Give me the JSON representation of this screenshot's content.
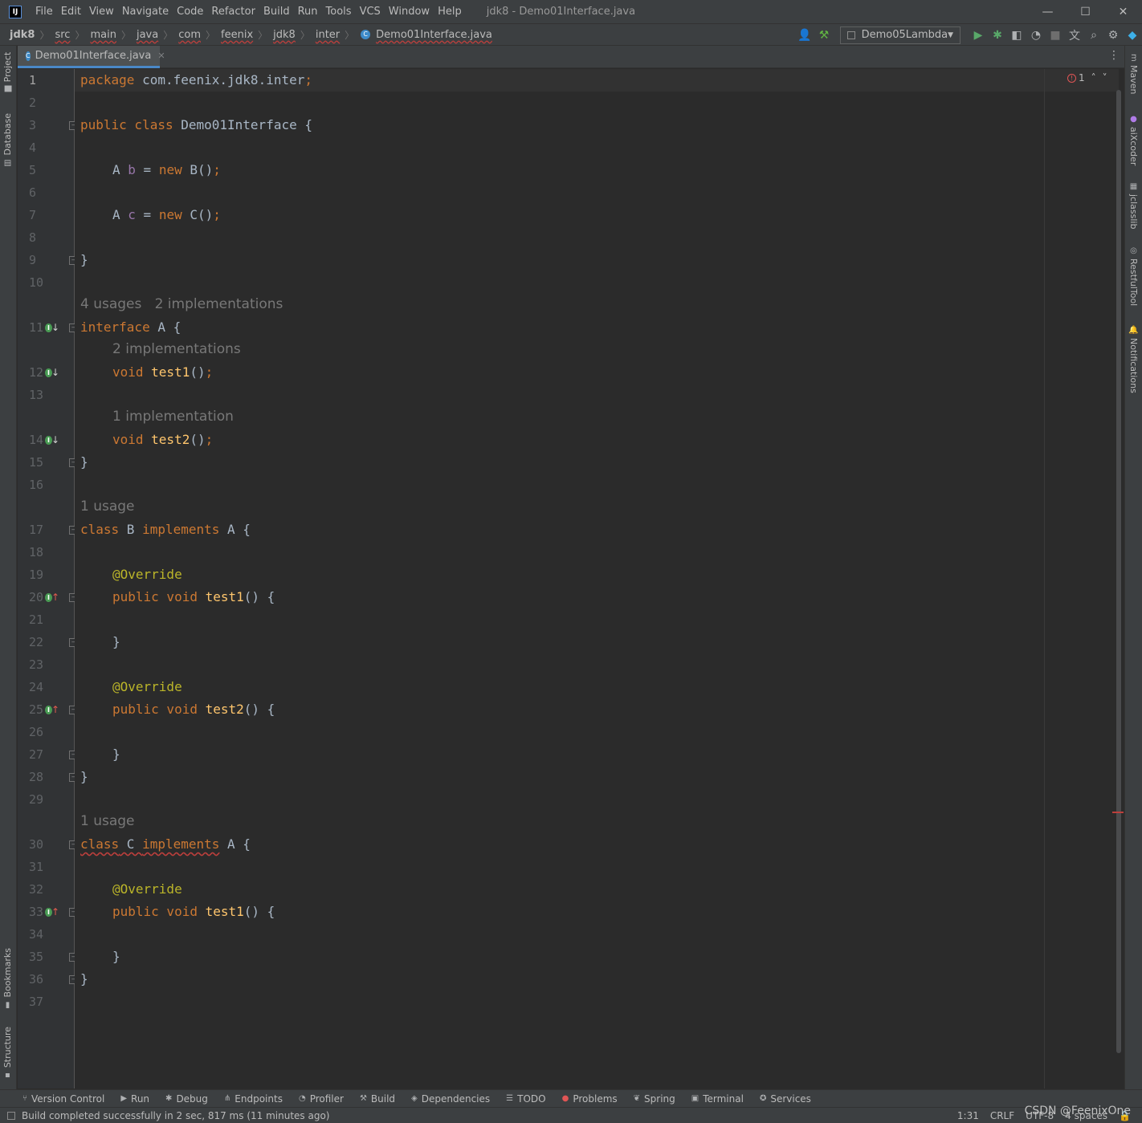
{
  "titlebar": {
    "logo": "IJ",
    "menu": [
      "File",
      "Edit",
      "View",
      "Navigate",
      "Code",
      "Refactor",
      "Build",
      "Run",
      "Tools",
      "VCS",
      "Window",
      "Help"
    ],
    "window_title": "jdk8 - Demo01Interface.java",
    "controls": {
      "minimize": "—",
      "maximize": "☐",
      "close": "✕"
    }
  },
  "breadcrumbs": [
    "jdk8",
    "src",
    "main",
    "java",
    "com",
    "feenix",
    "jdk8",
    "inter",
    "Demo01Interface.java"
  ],
  "run_config": {
    "name": "Demo05Lambda"
  },
  "toolbar_icons": [
    "user-icon",
    "build-hammer-icon",
    "run-icon",
    "debug-icon",
    "coverage-icon",
    "profile-icon",
    "stop-icon",
    "translate-icon",
    "search-icon",
    "settings-icon",
    "plugin-icon"
  ],
  "left_tabs": [
    "Project",
    "Database",
    "Bookmarks",
    "Structure"
  ],
  "right_tabs": [
    "Maven",
    "aiXcoder",
    "jclasslib",
    "RestfulTool",
    "Notifications"
  ],
  "tab": {
    "label": "Demo01Interface.java",
    "close": "✕"
  },
  "inspection": {
    "errors": "1",
    "error_icon": "!"
  },
  "code_lines": [
    {
      "n": "1"
    },
    {
      "n": "2"
    },
    {
      "n": "3"
    },
    {
      "n": "4"
    },
    {
      "n": "5"
    },
    {
      "n": "6"
    },
    {
      "n": "7"
    },
    {
      "n": "8"
    },
    {
      "n": "9"
    },
    {
      "n": "10"
    },
    {
      "n": "11"
    },
    {
      "n": "12"
    },
    {
      "n": "13"
    },
    {
      "n": "14"
    },
    {
      "n": "15"
    },
    {
      "n": "16"
    },
    {
      "n": "17"
    },
    {
      "n": "18"
    },
    {
      "n": "19"
    },
    {
      "n": "20"
    },
    {
      "n": "21"
    },
    {
      "n": "22"
    },
    {
      "n": "23"
    },
    {
      "n": "24"
    },
    {
      "n": "25"
    },
    {
      "n": "26"
    },
    {
      "n": "27"
    },
    {
      "n": "28"
    },
    {
      "n": "29"
    },
    {
      "n": "30"
    },
    {
      "n": "31"
    },
    {
      "n": "32"
    },
    {
      "n": "33"
    },
    {
      "n": "34"
    },
    {
      "n": "35"
    },
    {
      "n": "36"
    },
    {
      "n": "37"
    }
  ],
  "code": {
    "l1_kw": "package",
    "l1_rest": " com.feenix.jdk8.inter",
    "l1_semi": ";",
    "l3_kw": "public class",
    "l3_rest": " Demo01Interface {",
    "l5_a": "A ",
    "l5_var": "b",
    "l5_eq": " = ",
    "l5_new": "new",
    "l5_rest": " B()",
    "l5_semi": ";",
    "l7_a": "A ",
    "l7_var": "c",
    "l7_eq": " = ",
    "l7_new": "new",
    "l7_rest": " C()",
    "l7_semi": ";",
    "l9": "}",
    "h11": "4 usages   2 implementations",
    "l11_kw": "interface",
    "l11_rest": " A {",
    "h12": "2 implementations",
    "l12_kw": "void",
    "l12_fn": " test1",
    "l12_rest": "()",
    "l12_semi": ";",
    "h14": "1 implementation",
    "l14_kw": "void",
    "l14_fn": " test2",
    "l14_rest": "()",
    "l14_semi": ";",
    "l15": "}",
    "h17": "1 usage",
    "l17_kw": "class",
    "l17_b": " B ",
    "l17_impl": "implements",
    "l17_rest": " A {",
    "l19": "@Override",
    "l20_kw": "public void",
    "l20_fn": " test1",
    "l20_rest": "() {",
    "l22": "}",
    "l24": "@Override",
    "l25_kw": "public void",
    "l25_fn": " test2",
    "l25_rest": "() {",
    "l27": "}",
    "l28": "}",
    "h30": "1 usage",
    "l30_kw": "class",
    "l30_c": " C ",
    "l30_impl": "implements",
    "l30_rest": " A {",
    "l32": "@Override",
    "l33_kw": "public void",
    "l33_fn": " test1",
    "l33_rest": "() {",
    "l35": "}",
    "l36": "}"
  },
  "bottom_tools": [
    "Version Control",
    "Run",
    "Debug",
    "Endpoints",
    "Profiler",
    "Build",
    "Dependencies",
    "TODO",
    "Problems",
    "Spring",
    "Terminal",
    "Services"
  ],
  "status": {
    "message": "Build completed successfully in 2 sec, 817 ms (11 minutes ago)",
    "position": "1:31",
    "line_sep": "CRLF",
    "encoding": "UTF-8",
    "indent": "4 spaces"
  },
  "watermark": "CSDN @FeenixOne",
  "colors": {
    "keyword": "#cc7832",
    "method": "#ffc66d",
    "annotation": "#bbb529",
    "field": "#9876aa",
    "text": "#a9b7c6",
    "background": "#2b2b2b"
  }
}
